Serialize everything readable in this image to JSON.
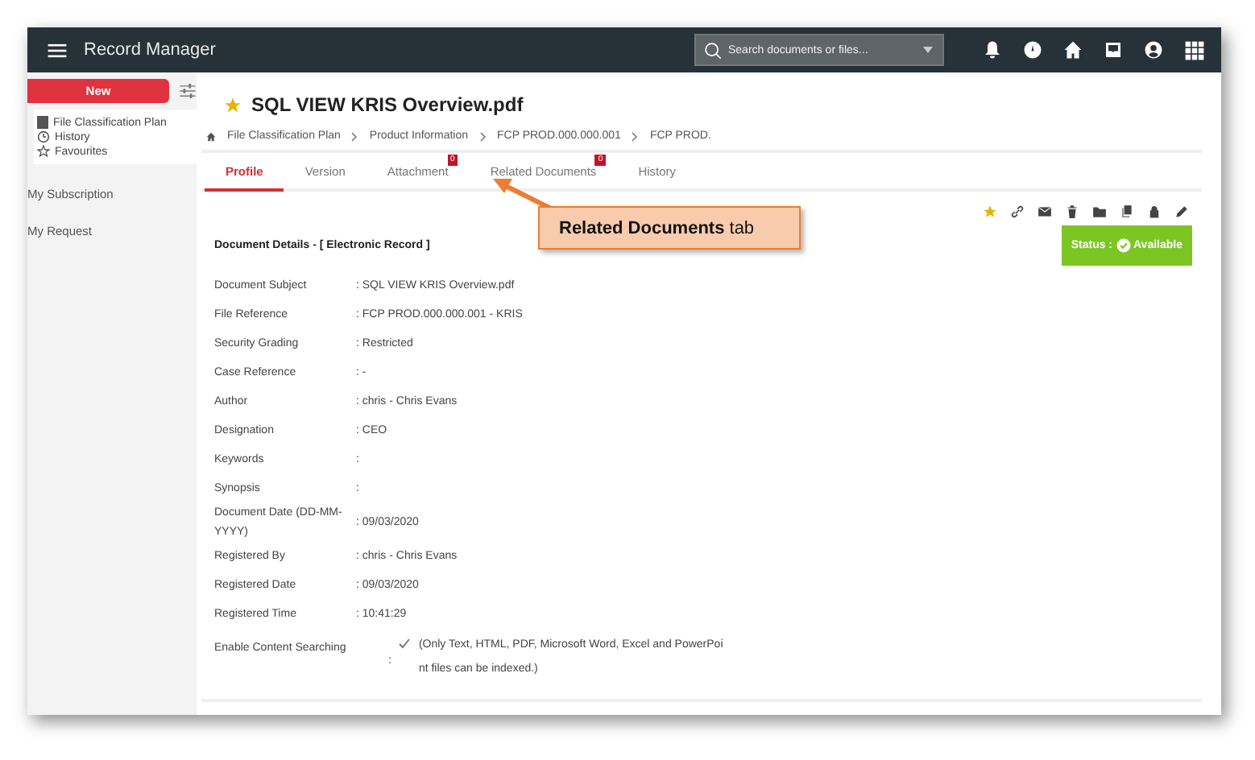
{
  "app": {
    "title": "Record Manager"
  },
  "search": {
    "placeholder": "Search documents or files..."
  },
  "sidebar": {
    "new_button": "New",
    "tree": [
      {
        "label": "File Classification Plan"
      },
      {
        "label": "History"
      },
      {
        "label": "Favourites"
      }
    ],
    "links": [
      "My Subscription",
      "My Request"
    ]
  },
  "document": {
    "title": "SQL VIEW KRIS Overview.pdf",
    "breadcrumb": [
      "File Classification Plan",
      "Product Information",
      "FCP PROD.000.000.001",
      "FCP PROD."
    ],
    "tabs": [
      {
        "label": "Profile",
        "selected": true
      },
      {
        "label": "Version",
        "selected": false
      },
      {
        "label": "Attachment",
        "selected": false,
        "badge": "0"
      },
      {
        "label": "Related Documents",
        "selected": false,
        "badge": "0"
      },
      {
        "label": "History",
        "selected": false
      }
    ],
    "section_title": "Document Details - [ Electronic Record ]",
    "status": {
      "label": "Status :",
      "value": "Available"
    },
    "fields": [
      {
        "label": "Document Subject",
        "value": ": SQL VIEW KRIS Overview.pdf"
      },
      {
        "label": "File Reference",
        "value": ": FCP PROD.000.000.001 - KRIS"
      },
      {
        "label": "Security Grading",
        "value": ": Restricted"
      },
      {
        "label": "Case Reference",
        "value": ": -"
      },
      {
        "label": "Author",
        "value": ": chris - Chris Evans"
      },
      {
        "label": "Designation",
        "value": ": CEO"
      },
      {
        "label": "Keywords",
        "value": ":"
      },
      {
        "label": "Synopsis",
        "value": ":"
      },
      {
        "label": "Document Date (DD-MM-YYYY)",
        "value": ": 09/03/2020"
      },
      {
        "label": "Registered By",
        "value": ": chris - Chris Evans"
      },
      {
        "label": "Registered Date",
        "value": ": 09/03/2020"
      },
      {
        "label": "Registered Time",
        "value": ": 10:41:29"
      }
    ],
    "content_search": {
      "label": "Enable Content Searching",
      "colon": ":",
      "checked": true,
      "note": "(Only Text, HTML, PDF, Microsoft Word, Excel and PowerPoint files can be indexed.)"
    }
  },
  "callout": {
    "text": "**Related Documents** tab"
  }
}
